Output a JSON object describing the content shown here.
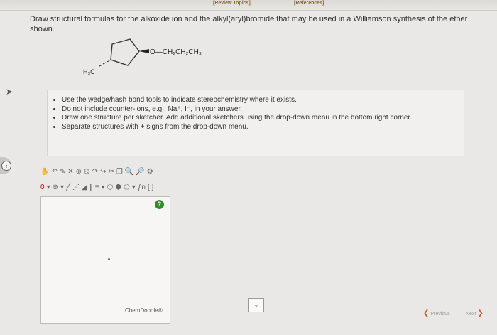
{
  "top_links": {
    "review": "[Review Topics]",
    "references": "[References]"
  },
  "question": {
    "text": "Draw structural formulas for the alkoxide ion and the alkyl(aryl)bromide that may be used in a Williamson synthesis of the ether shown."
  },
  "molecule": {
    "substituent": "O—CH₂CH₂CH₃",
    "methyl_label": "H₃C"
  },
  "instructions": [
    "Use the wedge/hash bond tools to indicate stereochemistry where it exists.",
    "Do not include counter-ions, e.g., Na⁺, I⁻, in your answer.",
    "Draw one structure per sketcher. Add additional sketchers using the drop-down menu in the bottom right corner.",
    "Separate structures with + signs from the drop-down menu."
  ],
  "editor": {
    "row2_charge": "0",
    "brand": "ChemDoodle®",
    "help": "?"
  },
  "nav": {
    "previous": "Previous",
    "next": "Next"
  },
  "colors": {
    "accent": "#cc5a2a",
    "help_green": "#2f8f2f",
    "link_brown": "#8b6a2f"
  }
}
